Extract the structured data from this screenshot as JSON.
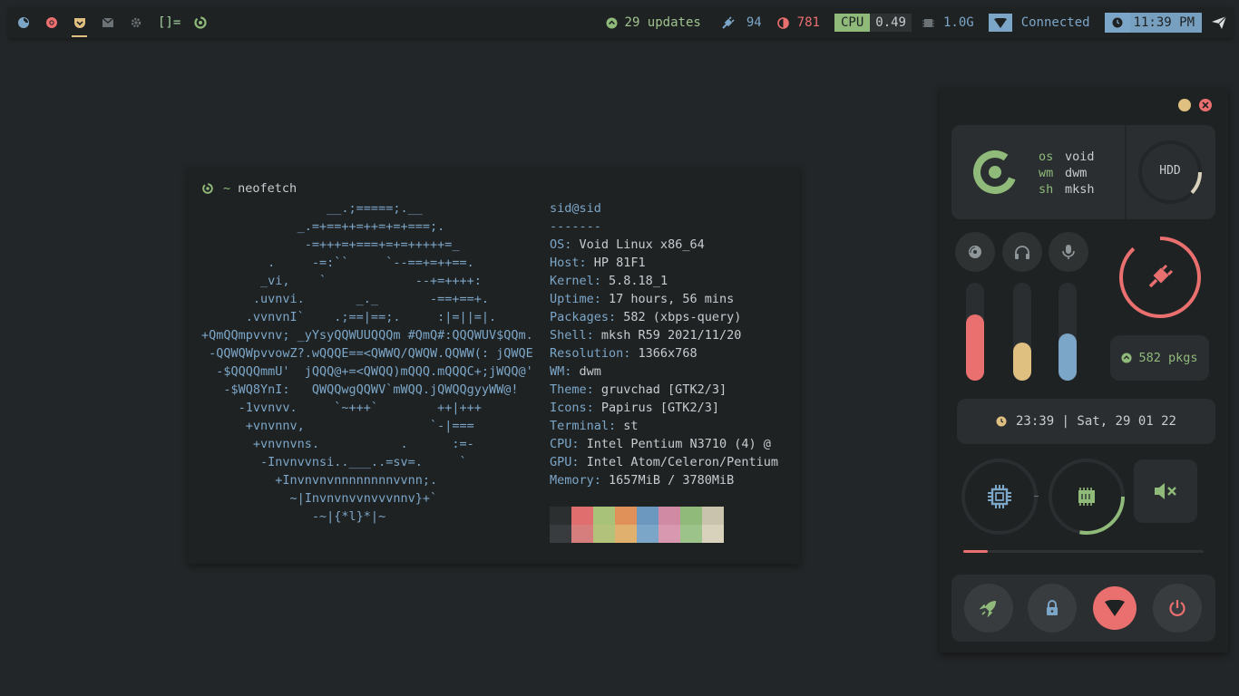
{
  "bar": {
    "layout_symbol": "[]=",
    "updates": "29 updates",
    "battery": "94",
    "brightness": "781",
    "cpu_label": "CPU",
    "cpu_value": "0.49",
    "memory": "1.0G",
    "network": "Connected",
    "time": "11:39 PM",
    "tag_icons": [
      "firefox-icon",
      "chrome-icon",
      "pocket-icon",
      "mail-icon",
      "settings-icon"
    ]
  },
  "terminal": {
    "prompt_tilde": "~",
    "command": "neofetch",
    "user_host": "sid@sid",
    "separator": "-------",
    "info": [
      {
        "key": "OS",
        "value": "Void Linux x86_64"
      },
      {
        "key": "Host",
        "value": "HP 81F1"
      },
      {
        "key": "Kernel",
        "value": "5.8.18_1"
      },
      {
        "key": "Uptime",
        "value": "17 hours, 56 mins"
      },
      {
        "key": "Packages",
        "value": "582 (xbps-query)"
      },
      {
        "key": "Shell",
        "value": "mksh R59 2021/11/20"
      },
      {
        "key": "Resolution",
        "value": "1366x768"
      },
      {
        "key": "WM",
        "value": "dwm"
      },
      {
        "key": "Theme",
        "value": "gruvchad [GTK2/3]"
      },
      {
        "key": "Icons",
        "value": "Papirus [GTK2/3]"
      },
      {
        "key": "Terminal",
        "value": "st"
      },
      {
        "key": "CPU",
        "value": "Intel Pentium N3710 (4) @"
      },
      {
        "key": "GPU",
        "value": "Intel Atom/Celeron/Pentium"
      },
      {
        "key": "Memory",
        "value": "1657MiB / 3780MiB"
      }
    ],
    "logo_lines": [
      "                 __.;=====;.__",
      "             _.=+==++=++=+=+===;.",
      "              -=+++=+===+=+=+++++=_",
      "         .     -=:``     `--==+=++==.",
      "        _vi,    `            --+=++++:",
      "       .uvnvi.       _._       -==+==+.",
      "      .vvnvnI`    .;==|==;.     :|=||=|.",
      "+QmQQmpvvnv; _yYsyQQWUUQQQm #QmQ#:QQQWUV$QQm.",
      " -QQWQWpvvowZ?.wQQQE==<QWWQ/QWQW.QQWW(: jQWQE",
      "  -$QQQQmmU'  jQQQ@+=<QWQQ)mQQQ.mQQQC+;jWQQ@'",
      "   -$WQ8YnI:   QWQQwgQQWV`mWQQ.jQWQQgyyWW@!",
      "     -1vvnvv.     `~+++`        ++|+++",
      "      +vnvnnv,                 `-|===",
      "       +vnvnvns.           .      :=-",
      "        -Invnvvnsi..___..=sv=.     `",
      "          +Invnvnvnnnnnnnnvvnn;.",
      "            ~|Invnvnvvnvvvnnv}+`",
      "               -~|{*l}*|~"
    ],
    "palette_top": [
      "#2b2f30",
      "#e06e6e",
      "#a9c27a",
      "#e0915a",
      "#6c98c0",
      "#d08aa4",
      "#8fba7a",
      "#c9c3ae"
    ],
    "palette_bottom": [
      "#383c3e",
      "#d67e7e",
      "#b3c27a",
      "#e0b06e",
      "#7ca6c8",
      "#d898b0",
      "#9cc48a",
      "#d8d2bc"
    ]
  },
  "panel": {
    "sysinfo": [
      {
        "key": "os",
        "value": "void"
      },
      {
        "key": "wm",
        "value": "dwm"
      },
      {
        "key": "sh",
        "value": "mksh"
      }
    ],
    "hdd_label": "HDD",
    "hdd_usage": 0.12,
    "volume_level": 0.68,
    "headphone_level": 0.39,
    "mic_level": 0.48,
    "battery_ring": 0.88,
    "packages": "582 pkgs",
    "clock": "23:39 | Sat, 29 01 22",
    "cpu_ring": 0.0,
    "ram_ring": 0.28,
    "brightness_bar": 0.1,
    "colors": {
      "red": "#ea6f6f",
      "yellow": "#e0c080",
      "blue": "#7ca6c8",
      "green": "#8fba7a"
    }
  }
}
